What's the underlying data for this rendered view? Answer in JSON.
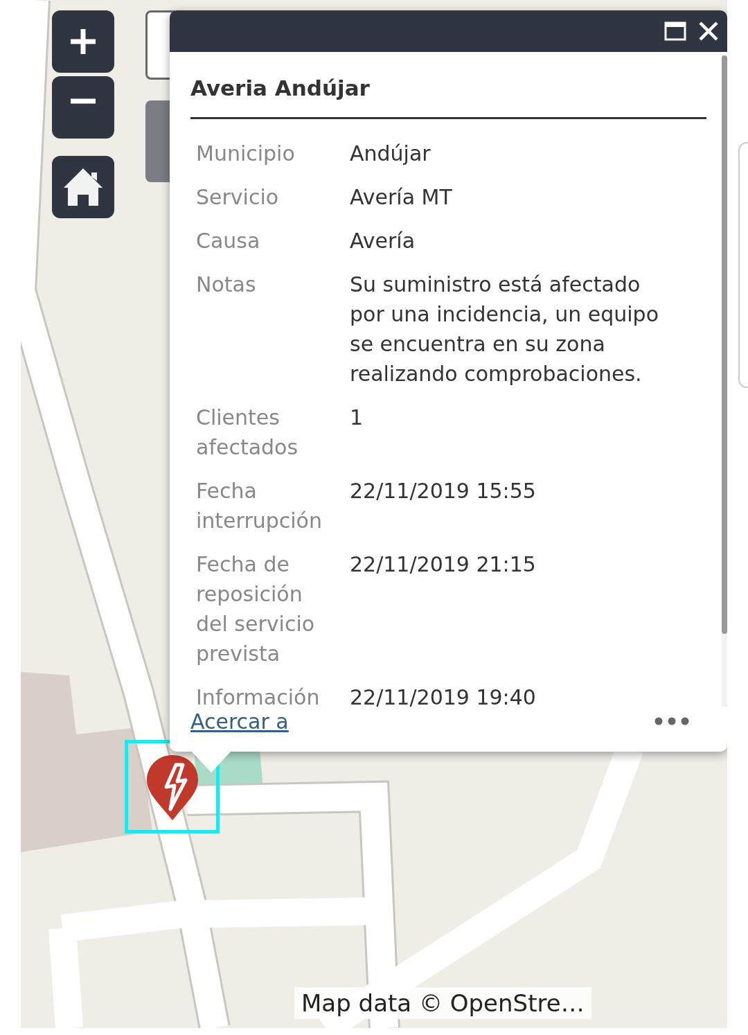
{
  "popup": {
    "title": "Averia Andújar",
    "fields": [
      {
        "label": "Municipio",
        "value": "Andújar"
      },
      {
        "label": "Servicio",
        "value": "Avería MT"
      },
      {
        "label": "Causa",
        "value": "Avería"
      },
      {
        "label": "Notas",
        "value": "Su suministro está afectado por una incidencia, un equipo se encuentra en su zona realizando comprobaciones."
      },
      {
        "label": "Clientes afectados",
        "value": "1"
      },
      {
        "label": "Fecha interrupción",
        "value": "22/11/2019 15:55"
      },
      {
        "label": "Fecha de reposición del servicio prevista",
        "value": "22/11/2019 21:15"
      },
      {
        "label": "Información",
        "value": "22/11/2019 19:40"
      }
    ],
    "footer_link": "Acercar a"
  },
  "attribution": "Map data © OpenStre…"
}
